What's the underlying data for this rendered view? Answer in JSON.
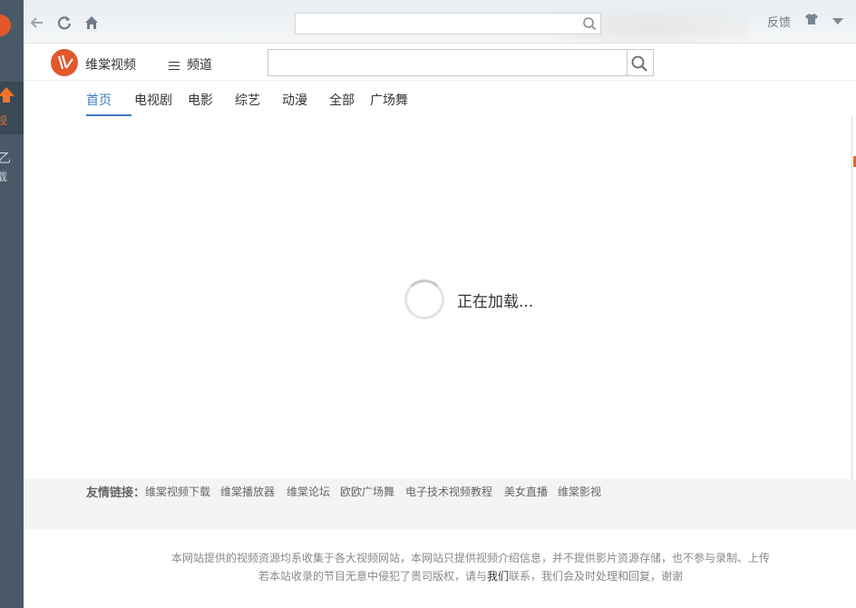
{
  "side": {
    "active_label": "视",
    "item2_label": "载",
    "item2_glyph": "乙"
  },
  "topbar": {
    "search_placeholder": "",
    "feedback": "反馈"
  },
  "header": {
    "brand": "维棠视频",
    "channel": "频道",
    "search_placeholder": ""
  },
  "nav": {
    "items": [
      "首页",
      "电视剧",
      "电影",
      "综艺",
      "动漫",
      "全部",
      "广场舞"
    ]
  },
  "loading": {
    "text": "正在加载..."
  },
  "links": {
    "title": "友情链接：",
    "items": [
      "维棠视频下载",
      "维棠播放器",
      "维棠论坛",
      "欧欧广场舞",
      "电子技术视频教程",
      "美女直播",
      "维棠影视"
    ]
  },
  "footer": {
    "line1": "本网站提供的视频资源均系收集于各大视频网站，本网站只提供视频介绍信息，并不提供影片资源存储，也不参与录制、上传",
    "line2_pre": "若本站收录的节目无意中侵犯了贵司版权，请与",
    "line2_link": "我们",
    "line2_post": "联系，我们会及时处理和回复，谢谢"
  },
  "colors": {
    "accent_blue": "#3d7bc2",
    "brand_orange": "#e4572a",
    "sidebar": "#4a5968"
  }
}
